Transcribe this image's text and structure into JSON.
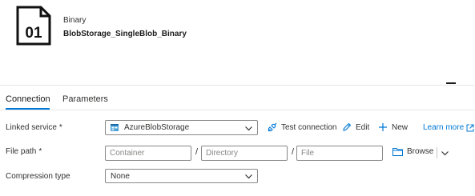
{
  "header": {
    "icon_text": "01",
    "dataset_type": "Binary",
    "dataset_name": "BlobStorage_SingleBlob_Binary"
  },
  "tabs": [
    {
      "label": "Connection",
      "active": true
    },
    {
      "label": "Parameters",
      "active": false
    }
  ],
  "linked_service": {
    "label": "Linked service",
    "required_mark": "*",
    "value": "AzureBlobStorage",
    "test_connection_label": "Test connection",
    "edit_label": "Edit",
    "new_label": "New",
    "learn_more_label": "Learn more"
  },
  "file_path": {
    "label": "File path",
    "required_mark": "*",
    "container_placeholder": "Container",
    "directory_placeholder": "Directory",
    "file_placeholder": "File",
    "separator": "/",
    "browse_label": "Browse"
  },
  "compression": {
    "label": "Compression type",
    "value": "None"
  },
  "colors": {
    "accent": "#0078d4",
    "text": "#323130",
    "border": "#8a8886"
  },
  "icons": [
    "binary-file-icon",
    "storage-icon",
    "plug-icon",
    "pencil-icon",
    "plus-icon",
    "external-link-icon",
    "folder-icon",
    "chevron-down-icon"
  ]
}
